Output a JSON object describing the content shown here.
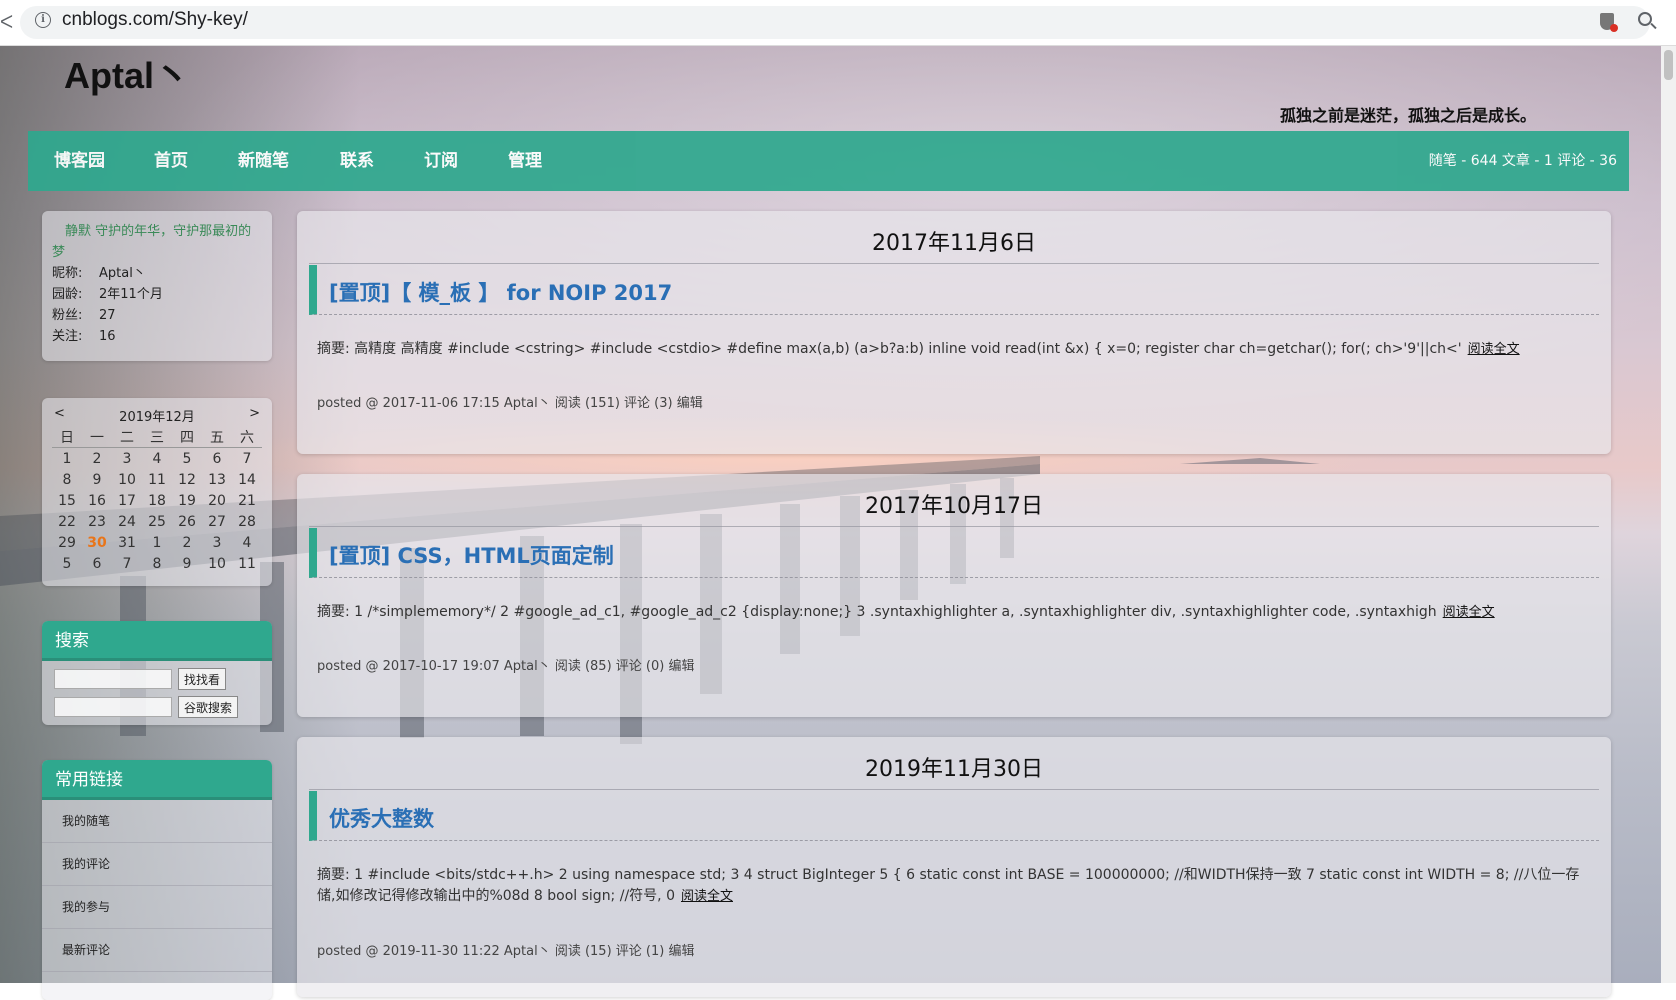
{
  "browser": {
    "url": "cnblogs.com/Shy-key/"
  },
  "header": {
    "title": "Aptal丶",
    "subtitle": "孤独之前是迷茫，孤独之后是成长。"
  },
  "nav": {
    "items": [
      "博客园",
      "首页",
      "新随笔",
      "联系",
      "订阅",
      "管理"
    ],
    "stats": "随笔 - 644  文章 - 1  评论 - 36"
  },
  "profile": {
    "motto": "静默 守护的年华，守护那最初的梦",
    "rows": [
      {
        "label": "昵称:",
        "value": "Aptal丶"
      },
      {
        "label": "园龄:",
        "value": "2年11个月"
      },
      {
        "label": "粉丝:",
        "value": "27"
      },
      {
        "label": "关注:",
        "value": "16"
      }
    ]
  },
  "calendar": {
    "prev": "<",
    "next": ">",
    "title": "2019年12月",
    "weekdays": [
      "日",
      "一",
      "二",
      "三",
      "四",
      "五",
      "六"
    ],
    "weeks": [
      [
        "1",
        "2",
        "3",
        "4",
        "5",
        "6",
        "7"
      ],
      [
        "8",
        "9",
        "10",
        "11",
        "12",
        "13",
        "14"
      ],
      [
        "15",
        "16",
        "17",
        "18",
        "19",
        "20",
        "21"
      ],
      [
        "22",
        "23",
        "24",
        "25",
        "26",
        "27",
        "28"
      ],
      [
        "29",
        "30",
        "31",
        "1",
        "2",
        "3",
        "4"
      ],
      [
        "5",
        "6",
        "7",
        "8",
        "9",
        "10",
        "11"
      ]
    ],
    "today": "30"
  },
  "search": {
    "heading": "搜索",
    "button1": "找找看",
    "button2": "谷歌搜索"
  },
  "links": {
    "heading": "常用链接",
    "items": [
      "我的随笔",
      "我的评论",
      "我的参与",
      "最新评论"
    ]
  },
  "posts": [
    {
      "date": "2017年11月6日",
      "title": "[置顶]【 模_板 】 for NOIP 2017",
      "summary": "摘要: 高精度 高精度 #include <cstring> #include <cstdio> #define max(a,b) (a>b?a:b) inline void read(int &x) { x=0; register char ch=getchar(); for(; ch>'9'||ch<'",
      "more": "阅读全文",
      "meta": "posted @ 2017-11-06 17:15 Aptal丶 阅读 (151) 评论 (3) 编辑"
    },
    {
      "date": "2017年10月17日",
      "title": "[置顶] CSS，HTML页面定制",
      "summary": "摘要: 1 /*simplememory*/ 2 #google_ad_c1, #google_ad_c2 {display:none;} 3 .syntaxhighlighter a, .syntaxhighlighter div, .syntaxhighlighter code, .syntaxhigh",
      "more": "阅读全文",
      "meta": "posted @ 2017-10-17 19:07 Aptal丶 阅读 (85) 评论 (0) 编辑"
    },
    {
      "date": "2019年11月30日",
      "title": "优秀大整数",
      "summary": "摘要: 1 #include <bits/stdc++.h> 2 using namespace std; 3 4 struct BigInteger 5 { 6 static const int BASE = 100000000; //和WIDTH保持一致 7 static const int WIDTH = 8; //八位一存储,如修改记得修改输出中的%08d 8 bool sign; //符号, 0",
      "more": "阅读全文",
      "meta": "posted @ 2019-11-30 11:22 Aptal丶 阅读 (15) 评论 (1) 编辑"
    }
  ],
  "colors": {
    "accent": "#2fa88e",
    "post_title": "#2a6fb5",
    "today": "#e8751a",
    "motto": "#3a8a58"
  }
}
